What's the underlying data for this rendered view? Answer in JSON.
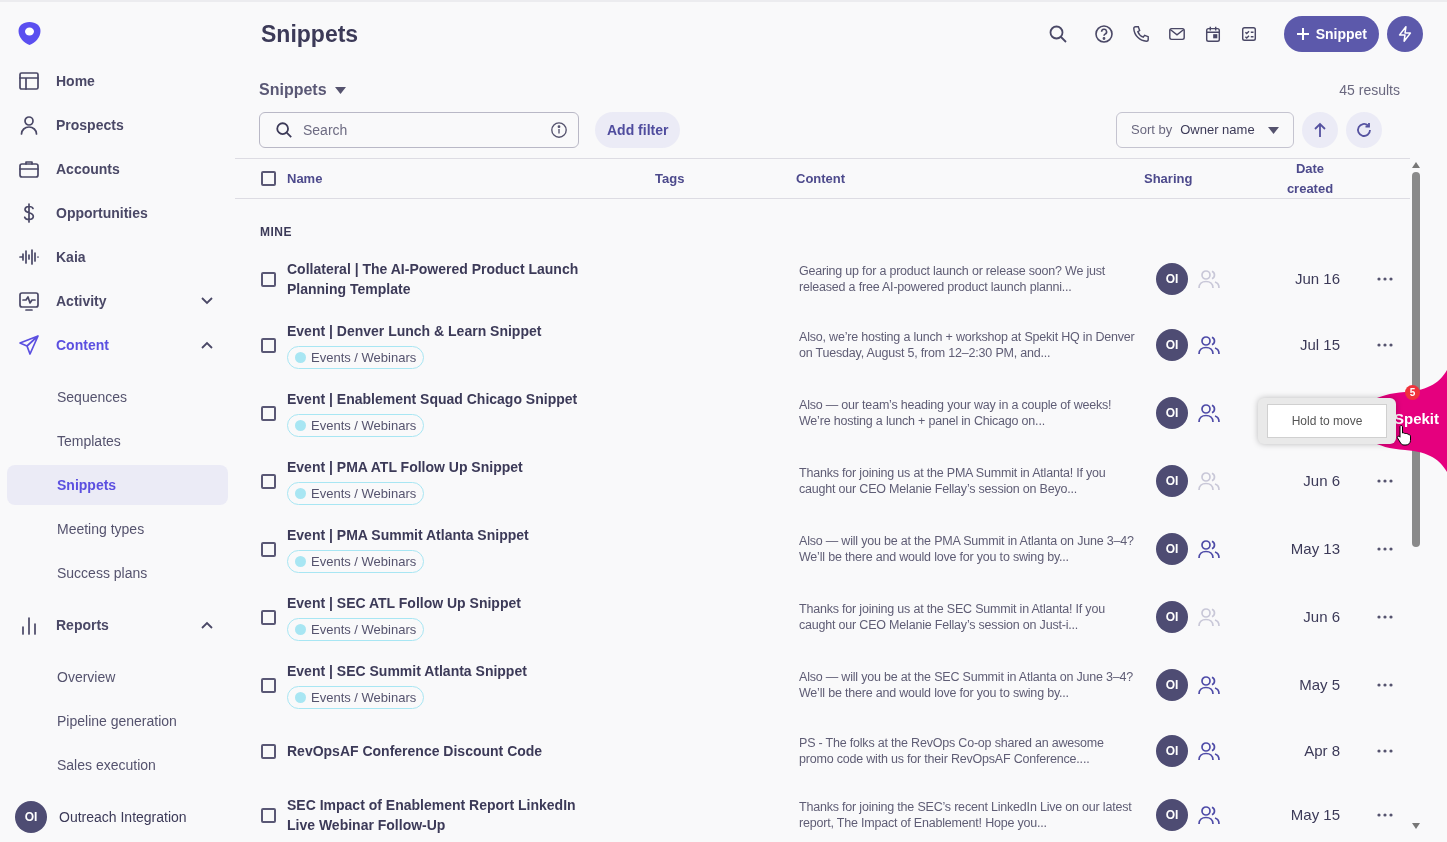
{
  "sidebar": {
    "items": [
      {
        "label": "Home",
        "selected": false
      },
      {
        "label": "Prospects",
        "selected": false
      },
      {
        "label": "Accounts",
        "selected": false
      },
      {
        "label": "Opportunities",
        "selected": false
      },
      {
        "label": "Kaia",
        "selected": false
      },
      {
        "label": "Activity",
        "selected": false,
        "expanded": false
      },
      {
        "label": "Content",
        "selected": true,
        "expanded": true,
        "children": [
          {
            "label": "Sequences",
            "selected": false
          },
          {
            "label": "Templates",
            "selected": false
          },
          {
            "label": "Snippets",
            "selected": true
          },
          {
            "label": "Meeting types",
            "selected": false
          },
          {
            "label": "Success plans",
            "selected": false
          }
        ]
      },
      {
        "label": "Reports",
        "selected": false,
        "expanded": true,
        "children": [
          {
            "label": "Overview",
            "selected": false
          },
          {
            "label": "Pipeline generation",
            "selected": false
          },
          {
            "label": "Sales execution",
            "selected": false
          }
        ]
      }
    ],
    "user": {
      "initials": "OI",
      "name": "Outreach Integration"
    }
  },
  "header": {
    "title": "Snippets",
    "new_button": "Snippet"
  },
  "toolbar": {
    "view": "Snippets",
    "results": "45 results",
    "search": {
      "placeholder": "Search"
    },
    "add_filter": "Add filter",
    "sort": {
      "label": "Sort by",
      "value": "Owner name"
    }
  },
  "table": {
    "select_all": {
      "checked": false
    },
    "columns": [
      "Name",
      "Tags",
      "Content",
      "Sharing",
      "Date created"
    ],
    "section": "MINE",
    "rows": [
      {
        "name": "Collateral | The AI-Powered Product Launch Planning Template",
        "content": "Gearing up for a product launch or release soon? We just released a free AI-powered product launch planni...",
        "owner": "OI",
        "shared": false,
        "date": "Jun 16",
        "checked": false
      },
      {
        "name": "Event | Denver Lunch & Learn Snippet",
        "tags": [
          {
            "label": "Events / Webinars",
            "color": "#a8e6f3"
          }
        ],
        "content": "Also, we’re hosting a lunch + workshop at Spekit HQ in Denver on Tuesday, August 5, from 12–2:30 PM, and...",
        "owner": "OI",
        "shared": true,
        "date": "Jul 15",
        "checked": false
      },
      {
        "name": "Event | Enablement Squad Chicago Snippet",
        "tags": [
          {
            "label": "Events / Webinars",
            "color": "#a8e6f3"
          }
        ],
        "content": "Also — our team’s heading your way in a couple of weeks! We’re hosting a lunch + panel in Chicago on...",
        "owner": "OI",
        "shared": true,
        "checked": false
      },
      {
        "name": "Event | PMA ATL Follow Up Snippet",
        "tags": [
          {
            "label": "Events / Webinars",
            "color": "#a8e6f3"
          }
        ],
        "content": "Thanks for joining us at the PMA Summit in Atlanta! If you caught our CEO Melanie Fellay’s session on Beyo...",
        "owner": "OI",
        "shared": false,
        "date": "Jun 6",
        "checked": false
      },
      {
        "name": "Event | PMA Summit Atlanta Snippet",
        "tags": [
          {
            "label": "Events / Webinars",
            "color": "#a8e6f3"
          }
        ],
        "content": "Also — will you be at the PMA Summit in Atlanta on June 3–4? We’ll be there and would love for you to swing by...",
        "owner": "OI",
        "shared": true,
        "date": "May 13",
        "checked": false
      },
      {
        "name": "Event | SEC ATL Follow Up Snippet",
        "tags": [
          {
            "label": "Events / Webinars",
            "color": "#a8e6f3"
          }
        ],
        "content": "Thanks for joining us at the SEC Summit in Atlanta! If you caught our CEO Melanie Fellay’s session on Just-i...",
        "owner": "OI",
        "shared": false,
        "date": "Jun 6",
        "checked": false
      },
      {
        "name": "Event | SEC Summit Atlanta Snippet",
        "tags": [
          {
            "label": "Events / Webinars",
            "color": "#a8e6f3"
          }
        ],
        "content": "Also — will you be at the SEC Summit in Atlanta on June 3–4? We’ll be there and would love for you to swing by...",
        "owner": "OI",
        "shared": true,
        "date": "May 5",
        "checked": false
      },
      {
        "name": "RevOpsAF Conference Discount Code",
        "content": "PS - The folks at the RevOps Co-op shared an awesome promo code with us for their RevOpsAF Conference....",
        "owner": "OI",
        "shared": true,
        "date": "Apr 8",
        "checked": false
      },
      {
        "name": "SEC Impact of Enablement Report LinkedIn Live Webinar Follow-Up",
        "content": "Thanks for joining the SEC’s recent LinkedIn Live on our latest report, The Impact of Enablement! Hope you...",
        "owner": "OI",
        "shared": true,
        "date": "May 15",
        "checked": false
      }
    ]
  },
  "widget": {
    "label": "Spekit",
    "badge": "5",
    "tooltip": "Hold to move"
  }
}
